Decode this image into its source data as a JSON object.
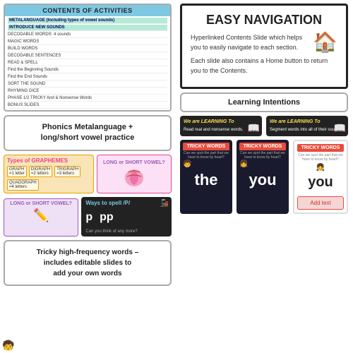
{
  "left": {
    "contents": {
      "title": "CONTENTS OF ACTIVITIES",
      "items": [
        {
          "text": "METALANGUAGE (Including types of vowel sounds)",
          "highlight": true
        },
        {
          "text": "INTRODUCE NEW SOUNDS",
          "highlight": true
        },
        {
          "text": "DECODABLE WORDS: 4 sounds",
          "highlight": false
        },
        {
          "text": "MAGIC WORDS",
          "highlight": false
        },
        {
          "text": "BUILD WORDS",
          "highlight": false
        },
        {
          "text": "DECODABLE SENTENCES",
          "highlight": false
        },
        {
          "text": "READ & SPELL",
          "highlight": false
        },
        {
          "text": "Find the Beginning Sounds",
          "highlight": false
        },
        {
          "text": "Find the End Sounds",
          "highlight": false
        },
        {
          "text": "SORT THE SOUND",
          "highlight": false
        },
        {
          "text": "RHYMING DICE",
          "highlight": false
        },
        {
          "text": "PHASE 1/2 TRICKY And & Nonsense Words",
          "highlight": false
        },
        {
          "text": "BONUS SLIDES",
          "highlight": false
        }
      ]
    },
    "phonics": {
      "line1": "Phonics Metalanguage +",
      "line2": "long/short vowel practice"
    },
    "graphemes": {
      "title": "Types of GRAPHEMES",
      "types": [
        {
          "name": "GRAPH",
          "sub": "= 1 letter"
        },
        {
          "name": "DIGRAPH",
          "sub": "= 2 letters"
        },
        {
          "name": "TRIGRAPH",
          "sub": "= 3 letters"
        },
        {
          "name": "QUADGRAPH",
          "sub": "= 4 letters"
        }
      ]
    },
    "longShort1": "LONG or SHORT VOWEL?",
    "longShort2": "LONG or SHORT VOWEL?",
    "waysToSpell": {
      "title": "Ways to spell /P/",
      "letters": [
        "p",
        "pp"
      ],
      "caption": "Can you think of any more?"
    },
    "tricky": {
      "line1": "Tricky high-frequency words –",
      "line2": "includes editable slides to",
      "line3": "add your own words"
    }
  },
  "right": {
    "easyNav": {
      "title": "EASY NAVIGATION",
      "para1": "Hyperlinked Contents Slide which helps you to easily navigate to each section.",
      "para2": "Each slide also contains a Home button to return you to the Contents.",
      "house": "🏠"
    },
    "learningIntentions": {
      "title": "Learning Intentions"
    },
    "slides": [
      {
        "title": "We are LEARNING To",
        "text": "Read real and nonsense words.",
        "badge": "📖"
      },
      {
        "title": "We are LEARNING To",
        "text": "Segment words into all of their sounds.",
        "badge": "📖"
      }
    ],
    "trickyWords": {
      "darkCard": {
        "header": "TRICKY WORDS",
        "subheader": "Can we spot the part that we have to know by heart?",
        "words": [
          "the",
          "you"
        ],
        "badge": "👦"
      },
      "lightCard": {
        "header": "TRICKY WORDS",
        "subheader": "Can we spot the part that we have to know by heart?",
        "addText": "Add text",
        "word": "you"
      }
    }
  }
}
